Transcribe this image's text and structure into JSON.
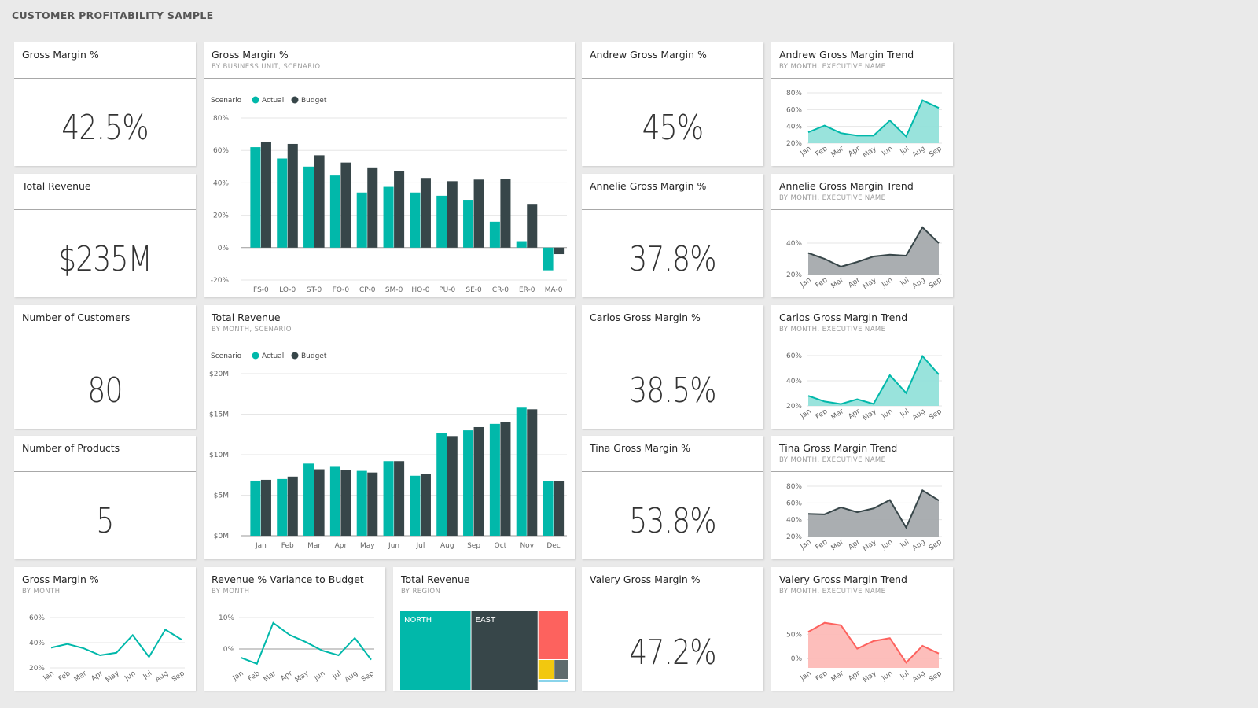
{
  "dashboard": {
    "title": "CUSTOMER PROFITABILITY SAMPLE"
  },
  "colors": {
    "teal": "#01b8aa",
    "teal_fill": "#93e1da",
    "dark": "#374649",
    "gray_fill": "#a5aaad",
    "red": "#fd625e",
    "red_fill": "#fdbab7",
    "yellow": "#f2c80f",
    "slate": "#5f6b6d",
    "light_blue": "#8ad4eb"
  },
  "kpis": {
    "gross_margin": {
      "title": "Gross Margin %",
      "value": "42.5%"
    },
    "total_revenue": {
      "title": "Total Revenue",
      "value": "$235M"
    },
    "num_customers": {
      "title": "Number of Customers",
      "value": "80"
    },
    "num_products": {
      "title": "Number of Products",
      "value": "5"
    },
    "andrew": {
      "title": "Andrew Gross Margin %",
      "value": "45%"
    },
    "annelie": {
      "title": "Annelie Gross Margin %",
      "value": "37.8%"
    },
    "carlos": {
      "title": "Carlos Gross Margin %",
      "value": "38.5%"
    },
    "tina": {
      "title": "Tina Gross Margin %",
      "value": "53.8%"
    },
    "valery": {
      "title": "Valery Gross Margin %",
      "value": "47.2%"
    }
  },
  "tiles": {
    "gm_by_bu": {
      "title": "Gross Margin %",
      "subtitle": "BY BUSINESS UNIT, SCENARIO"
    },
    "rev_by_month": {
      "title": "Total Revenue",
      "subtitle": "BY MONTH, SCENARIO"
    },
    "gm_by_month": {
      "title": "Gross Margin %",
      "subtitle": "BY MONTH"
    },
    "variance": {
      "title": "Revenue % Variance to Budget",
      "subtitle": "BY MONTH"
    },
    "rev_by_region": {
      "title": "Total Revenue",
      "subtitle": "BY REGION"
    },
    "andrew_trend": {
      "title": "Andrew Gross Margin Trend",
      "subtitle": "BY MONTH, EXECUTIVE NAME"
    },
    "annelie_trend": {
      "title": "Annelie Gross Margin Trend",
      "subtitle": "BY MONTH, EXECUTIVE NAME"
    },
    "carlos_trend": {
      "title": "Carlos Gross Margin Trend",
      "subtitle": "BY MONTH, EXECUTIVE NAME"
    },
    "tina_trend": {
      "title": "Tina Gross Margin Trend",
      "subtitle": "BY MONTH, EXECUTIVE NAME"
    },
    "valery_trend": {
      "title": "Valery Gross Margin Trend",
      "subtitle": "BY MONTH, EXECUTIVE NAME"
    }
  },
  "chart_data": [
    {
      "id": "gm_by_bu",
      "type": "bar",
      "title": "Gross Margin %",
      "subtitle": "BY BUSINESS UNIT, SCENARIO",
      "legend_title": "Scenario",
      "legend_position": "top-left",
      "categories": [
        "FS-0",
        "LO-0",
        "ST-0",
        "FO-0",
        "CP-0",
        "SM-0",
        "HO-0",
        "PU-0",
        "SE-0",
        "CR-0",
        "ER-0",
        "MA-0"
      ],
      "series": [
        {
          "name": "Actual",
          "color": "#01b8aa",
          "values": [
            62,
            55,
            50,
            44.5,
            34,
            37.5,
            34,
            32,
            29.5,
            16,
            4,
            -14
          ]
        },
        {
          "name": "Budget",
          "color": "#374649",
          "values": [
            65,
            64,
            57,
            52.5,
            49.5,
            47,
            43,
            41,
            42,
            42.5,
            27,
            -4
          ]
        }
      ],
      "ylim": [
        -20,
        80
      ],
      "yticks": [
        -20,
        0,
        20,
        40,
        60,
        80
      ],
      "ytick_labels": [
        "-20%",
        "0%",
        "20%",
        "40%",
        "60%",
        "80%"
      ],
      "grid": true
    },
    {
      "id": "rev_by_month",
      "type": "bar",
      "title": "Total Revenue",
      "subtitle": "BY MONTH, SCENARIO",
      "legend_title": "Scenario",
      "legend_position": "top-left",
      "categories": [
        "Jan",
        "Feb",
        "Mar",
        "Apr",
        "May",
        "Jun",
        "Jul",
        "Aug",
        "Sep",
        "Oct",
        "Nov",
        "Dec"
      ],
      "series": [
        {
          "name": "Actual",
          "color": "#01b8aa",
          "values": [
            6.8,
            7.0,
            8.9,
            8.5,
            8.0,
            9.2,
            7.4,
            12.7,
            13.0,
            13.8,
            15.8,
            6.7
          ]
        },
        {
          "name": "Budget",
          "color": "#374649",
          "values": [
            6.9,
            7.3,
            8.2,
            8.1,
            7.8,
            9.2,
            7.6,
            12.3,
            13.4,
            14.0,
            15.6,
            6.7
          ]
        }
      ],
      "ylim": [
        0,
        20
      ],
      "yticks": [
        0,
        5,
        10,
        15,
        20
      ],
      "ytick_labels": [
        "$0M",
        "$5M",
        "$10M",
        "$15M",
        "$20M"
      ],
      "grid": true
    },
    {
      "id": "gm_by_month",
      "type": "line",
      "categories": [
        "Jan",
        "Feb",
        "Mar",
        "Apr",
        "May",
        "Jun",
        "Jul",
        "Aug",
        "Sep"
      ],
      "series": [
        {
          "name": "Gross Margin %",
          "color": "#01b8aa",
          "values": [
            36,
            39,
            35.5,
            30,
            32,
            46,
            28.7,
            50.4,
            42.4
          ]
        }
      ],
      "ylim": [
        20,
        60
      ],
      "yticks": [
        20,
        40,
        60
      ],
      "ytick_labels": [
        "20%",
        "40%",
        "60%"
      ],
      "grid": true
    },
    {
      "id": "variance",
      "type": "line",
      "categories": [
        "Jan",
        "Feb",
        "Mar",
        "Apr",
        "May",
        "Jun",
        "Jul",
        "Aug",
        "Sep"
      ],
      "series": [
        {
          "name": "Revenue % Variance to Budget",
          "color": "#01b8aa",
          "values": [
            -2.7,
            -4.7,
            8.3,
            4.5,
            2.2,
            -0.5,
            -2.0,
            3.5,
            -3.4
          ]
        }
      ],
      "ylim": [
        -6,
        10
      ],
      "yticks": [
        0,
        10
      ],
      "ytick_labels": [
        "0%",
        "10%"
      ],
      "grid": true,
      "zero_line": true
    },
    {
      "id": "rev_by_region",
      "type": "treemap",
      "items": [
        {
          "label": "NORTH",
          "share": 0.4,
          "color": "#01b8aa"
        },
        {
          "label": "EAST",
          "share": 0.38,
          "color": "#374649"
        },
        {
          "label": "",
          "share": 0.12,
          "color": "#fd625e"
        },
        {
          "label": "",
          "share": 0.04,
          "color": "#f2c80f"
        },
        {
          "label": "",
          "share": 0.04,
          "color": "#5f6b6d"
        },
        {
          "label": "",
          "share": 0.02,
          "color": "#8ad4eb"
        }
      ]
    },
    {
      "id": "andrew_trend",
      "type": "area",
      "categories": [
        "Jan",
        "Feb",
        "Mar",
        "Apr",
        "May",
        "Jun",
        "Jul",
        "Aug",
        "Sep"
      ],
      "series": [
        {
          "name": "Andrew",
          "color": "#01b8aa",
          "fill": "#93e1da",
          "values": [
            33,
            41,
            32,
            29,
            29,
            47,
            28,
            71,
            62
          ]
        }
      ],
      "ylim": [
        20,
        80
      ],
      "yticks": [
        20,
        40,
        60,
        80
      ],
      "ytick_labels": [
        "20%",
        "40%",
        "60%",
        "80%"
      ],
      "grid": true
    },
    {
      "id": "annelie_trend",
      "type": "area",
      "categories": [
        "Jan",
        "Feb",
        "Mar",
        "Apr",
        "May",
        "Jun",
        "Jul",
        "Aug",
        "Sep"
      ],
      "series": [
        {
          "name": "Annelie",
          "color": "#374649",
          "fill": "#a5aaad",
          "values": [
            33.7,
            30,
            25,
            28,
            31.5,
            32.6,
            32,
            50,
            40
          ]
        }
      ],
      "ylim": [
        20,
        52
      ],
      "yticks": [
        20,
        40
      ],
      "ytick_labels": [
        "20%",
        "40%"
      ],
      "grid": true
    },
    {
      "id": "carlos_trend",
      "type": "area",
      "categories": [
        "Jan",
        "Feb",
        "Mar",
        "Apr",
        "May",
        "Jun",
        "Jul",
        "Aug",
        "Sep"
      ],
      "series": [
        {
          "name": "Carlos",
          "color": "#01b8aa",
          "fill": "#93e1da",
          "values": [
            28,
            23.5,
            21.5,
            25.3,
            21.6,
            44.4,
            30.3,
            59.6,
            45
          ]
        }
      ],
      "ylim": [
        20,
        60
      ],
      "yticks": [
        20,
        40,
        60
      ],
      "ytick_labels": [
        "20%",
        "40%",
        "60%"
      ],
      "grid": true
    },
    {
      "id": "tina_trend",
      "type": "area",
      "categories": [
        "Jan",
        "Feb",
        "Mar",
        "Apr",
        "May",
        "Jun",
        "Jul",
        "Aug",
        "Sep"
      ],
      "series": [
        {
          "name": "Tina",
          "color": "#374649",
          "fill": "#a5aaad",
          "values": [
            47,
            46.4,
            54.8,
            49,
            53.5,
            63.5,
            30.6,
            75,
            63
          ]
        }
      ],
      "ylim": [
        20,
        80
      ],
      "yticks": [
        20,
        40,
        60,
        80
      ],
      "ytick_labels": [
        "20%",
        "40%",
        "60%",
        "80%"
      ],
      "grid": true
    },
    {
      "id": "valery_trend",
      "type": "area",
      "categories": [
        "Jan",
        "Feb",
        "Mar",
        "Apr",
        "May",
        "Jun",
        "Jul",
        "Aug",
        "Sep"
      ],
      "series": [
        {
          "name": "Valery",
          "color": "#fd625e",
          "fill": "#fdbab7",
          "values": [
            55,
            74,
            69,
            20,
            36,
            42,
            -9,
            26,
            10
          ]
        }
      ],
      "ylim": [
        -20,
        85
      ],
      "yticks": [
        0,
        50
      ],
      "ytick_labels": [
        "0%",
        "50%"
      ],
      "grid": true,
      "zero_line": true
    }
  ]
}
